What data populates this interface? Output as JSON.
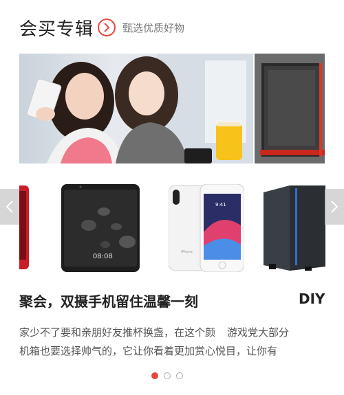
{
  "header": {
    "title": "会买专辑",
    "subtitle": "甄选优质好物"
  },
  "slides": [
    {
      "title": "聚会，双摄手机留住温馨一刻",
      "desc_line1": "家少不了要和亲朋好友推杯换盏，在这个颜",
      "desc_line2": "机箱也要选择帅气的，它让你看着更加赏心悦目，让你有"
    },
    {
      "title": "DIY",
      "desc_line1": "游戏党大部分"
    }
  ],
  "products": [
    {
      "icon": "red-phone"
    },
    {
      "icon": "huawei-mate-phone",
      "screen_time": "08:08"
    },
    {
      "icon": "iphone-8-plus",
      "screen_time": "9:41"
    },
    {
      "icon": "pc-tower-case"
    }
  ],
  "pagination": {
    "count": 3,
    "active": 0
  },
  "colors": {
    "accent": "#e8473c",
    "text": "#222222",
    "muted": "#777777"
  }
}
